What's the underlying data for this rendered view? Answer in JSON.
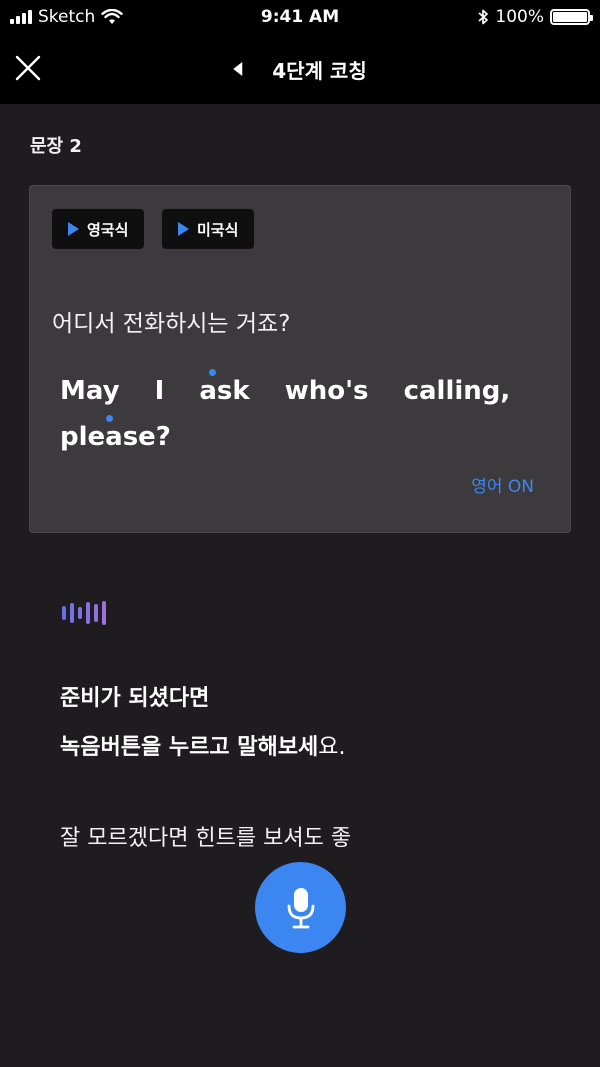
{
  "status_bar": {
    "carrier": "Sketch",
    "time": "9:41 AM",
    "battery": "100%"
  },
  "nav": {
    "title": "4단계 코칭",
    "close_icon": "close-icon",
    "back_icon": "back-arrow-icon"
  },
  "section": {
    "label": "문장 2"
  },
  "card": {
    "accent_buttons": [
      {
        "label": "영국식",
        "icon": "play-icon"
      },
      {
        "label": "미국식",
        "icon": "play-icon"
      }
    ],
    "korean_sentence": "어디서 전화하시는 거죠?",
    "english_line1": "May I ask who's calling,",
    "english_line2": "please?",
    "english_toggle": "영어 ON",
    "stress_dot_color": "#3b86f0"
  },
  "instructions": {
    "line1": "준비가 되셨다면",
    "line2_bold": "녹음버튼을 누르고 말해보세",
    "line2_light": "요.",
    "hint": "잘 모르겠다면 힌트를 보셔도 좋"
  },
  "mic_button": {
    "icon": "microphone-icon",
    "color": "#3b86f0"
  },
  "colors": {
    "background": "#1e1c1f",
    "card": "#3c3a3d",
    "accent": "#3b86f0",
    "wave_gradient": [
      "#6a6ee6",
      "#9d6fe0"
    ]
  }
}
